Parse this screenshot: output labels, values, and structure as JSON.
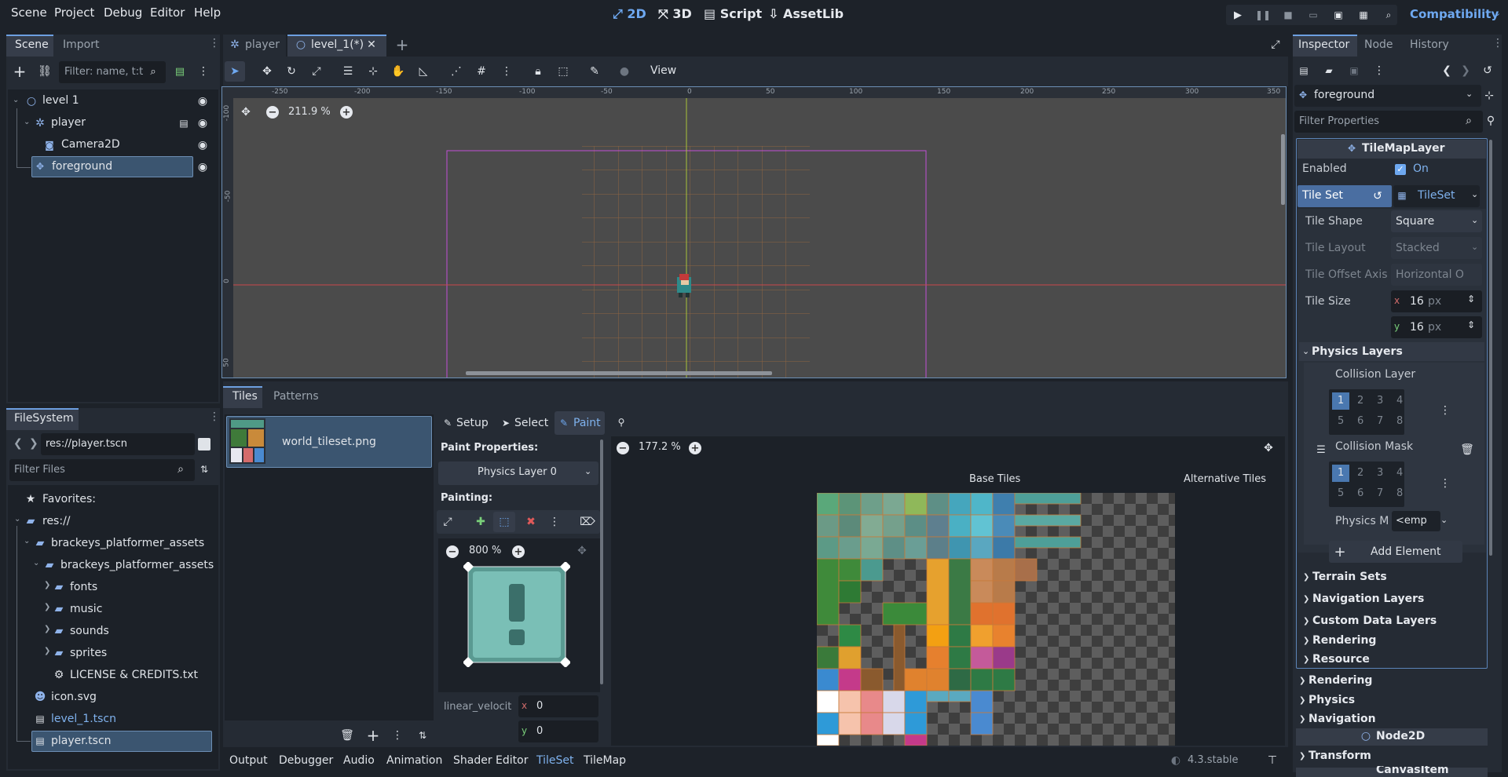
{
  "menubar": {
    "items": [
      "Scene",
      "Project",
      "Debug",
      "Editor",
      "Help"
    ],
    "modes": [
      "2D",
      "3D",
      "Script",
      "AssetLib"
    ],
    "renderer": "Compatibility"
  },
  "scene_dock": {
    "tabs": [
      "Scene",
      "Import"
    ],
    "filter_placeholder": "Filter: name, t:t",
    "tree": [
      "level 1",
      "player",
      "Camera2D",
      "foreground"
    ]
  },
  "filesystem": {
    "tab": "FileSystem",
    "path": "res://player.tscn",
    "filter_placeholder": "Filter Files",
    "items": [
      "Favorites:",
      "res://",
      "brackeys_platformer_assets",
      "brackeys_platformer_assets",
      "fonts",
      "music",
      "sounds",
      "sprites",
      "LICENSE & CREDITS.txt",
      "icon.svg",
      "level_1.tscn",
      "player.tscn"
    ]
  },
  "editor_tabs": [
    "player",
    "level_1(*)"
  ],
  "toolbar": {
    "view": "View"
  },
  "viewport": {
    "zoom": "211.9 %",
    "ruler_h": [
      "-250",
      "-200",
      "-150",
      "-100",
      "-50",
      "0",
      "50",
      "100",
      "150",
      "200",
      "250",
      "300",
      "350"
    ],
    "ruler_v": [
      "-100",
      "-50",
      "0",
      "50"
    ]
  },
  "bottom": {
    "tabs": [
      "Tiles",
      "Patterns"
    ],
    "tileset_source": "world_tileset.png",
    "modes": [
      "Setup",
      "Select",
      "Paint"
    ],
    "paint_properties": "Paint Properties:",
    "physics_layer": "Physics Layer 0",
    "painting": "Painting:",
    "preview_zoom": "800 %",
    "prop_name": "linear_velocit",
    "prop_x": "0",
    "prop_y": "0",
    "atlas_zoom": "177.2 %",
    "base_tiles": "Base Tiles",
    "alt_tiles": "Alternative Tiles"
  },
  "bottom_bar": {
    "tabs": [
      "Output",
      "Debugger",
      "Audio",
      "Animation",
      "Shader Editor",
      "TileSet",
      "TileMap"
    ],
    "version": "4.3.stable"
  },
  "inspector": {
    "tabs": [
      "Inspector",
      "Node",
      "History"
    ],
    "node": "foreground",
    "filter_placeholder": "Filter Properties",
    "class": "TileMapLayer",
    "enabled_label": "Enabled",
    "enabled_value": "On",
    "tileset_label": "Tile Set",
    "tileset_value": "TileSet",
    "tile_shape_label": "Tile Shape",
    "tile_shape": "Square",
    "tile_layout_label": "Tile Layout",
    "tile_layout": "Stacked",
    "offset_axis_label": "Tile Offset Axis",
    "offset_axis": "Horizontal O",
    "tile_size_label": "Tile Size",
    "size_x": "16",
    "size_y": "16",
    "px": "px",
    "physics_layers": "Physics Layers",
    "collision_layer": "Collision Layer",
    "collision_mask": "Collision Mask",
    "physics_m": "Physics M",
    "physics_m_value": "<emp",
    "bits": [
      "1",
      "2",
      "3",
      "4",
      "5",
      "6",
      "7",
      "8"
    ],
    "add_element": "Add Element",
    "sections": [
      "Terrain Sets",
      "Navigation Layers",
      "Custom Data Layers",
      "Rendering",
      "Resource"
    ],
    "outer_sections": [
      "Rendering",
      "Physics",
      "Navigation"
    ],
    "node2d": "Node2D",
    "transform": "Transform",
    "canvas_item": "CanvasItem"
  }
}
